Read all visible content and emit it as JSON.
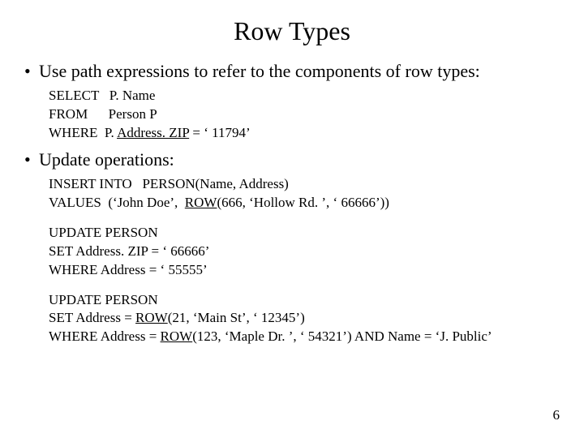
{
  "title": "Row Types",
  "bullets": {
    "b1": "Use path expressions to refer to the components of row types:",
    "b2": "Update operations:"
  },
  "code1": {
    "l1a": "SELECT   P. Name",
    "l2a": "FROM      Person P",
    "l3a": "WHERE  P. ",
    "l3b": "Address. ZIP",
    "l3c": " = ‘ 11794’"
  },
  "code2": {
    "l1": "INSERT INTO   PERSON(Name, Address)",
    "l2a": "VALUES  (‘John Doe’,  ",
    "l2b": "ROW",
    "l2c": "(666, ‘Hollow Rd. ’, ‘ 66666’))"
  },
  "code3": {
    "l1": "UPDATE  PERSON",
    "l2": "SET  Address. ZIP = ‘ 66666’",
    "l3": "WHERE  Address = ‘ 55555’"
  },
  "code4": {
    "l1": "UPDATE  PERSON",
    "l2a": "SET  Address = ",
    "l2b": "ROW",
    "l2c": "(21, ‘Main St’, ‘ 12345’)",
    "l3a": "WHERE  Address = ",
    "l3b": "ROW",
    "l3c": "(123, ‘Maple Dr. ’, ‘ 54321’)  AND  Name = ‘J. Public’"
  },
  "pagenum": "6"
}
